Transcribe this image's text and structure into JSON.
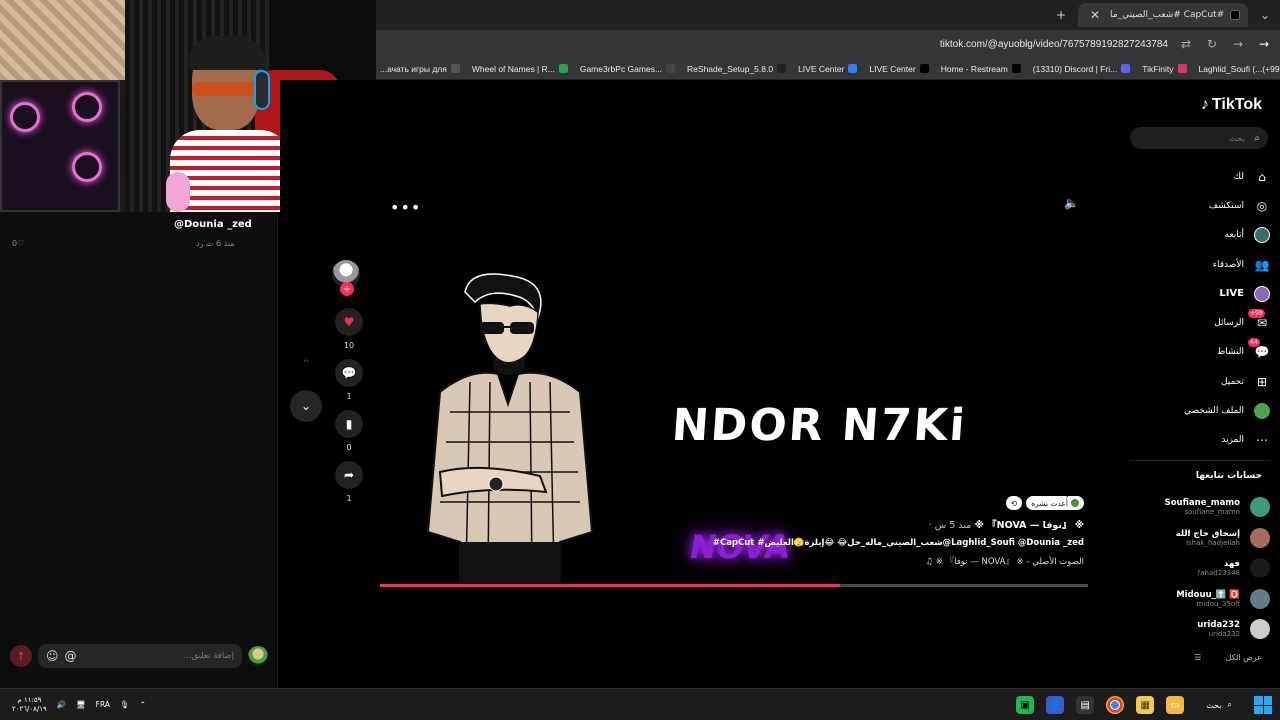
{
  "browser": {
    "tab_title": "شعب_الصيني_ما# CapCut#...",
    "url": "tiktok.com/@ayuoblg/video/7675789192827243784",
    "bookmarks": [
      {
        "label": "...ачать игры для",
        "color": "#555"
      },
      {
        "label": "Wheel of Names | R...",
        "color": "#2fa34a"
      },
      {
        "label": "Game3rbPc Games...",
        "color": "#444"
      },
      {
        "label": "ReShade_Setup_5.8.0",
        "color": "#222"
      },
      {
        "label": "LIVE Center",
        "color": "#2d7ff9"
      },
      {
        "label": "LIVE Center",
        "color": "#000"
      },
      {
        "label": "Home - Restream",
        "color": "#000"
      },
      {
        "label": "(13310) Discord | Fri...",
        "color": "#5865f2"
      },
      {
        "label": "TikFinity",
        "color": "#e2336a"
      },
      {
        "label": "Laghlid_Soufi (...(+99)",
        "color": "#c23"
      }
    ]
  },
  "comments": {
    "user": "@Dounia _zed",
    "meta": "منذ 6 ث    رد",
    "likes": "0♡",
    "input_placeholder": "...إضافة تعليق"
  },
  "video": {
    "headline": "NDOR N7Ki",
    "overlay_text": "NOVA",
    "progress_percent": 65,
    "actions": {
      "likes": "10",
      "comments": "1",
      "saves": "0",
      "shares": "1"
    },
    "caption": {
      "badge_reposted": "أُعدت نشره",
      "title": "※ 『NOVA — نوفا』 ※",
      "time": "· منذ 5 س",
      "tags": "#CapCut #شعب_الصيني_ماله_حل😂 😂إيلزة🫣العليض@Laghlid_Soufi @Dounia _zed",
      "sound": "♫ ※ 『نوفا — NOVA』 ※ - الصوت الأصلي"
    }
  },
  "sidebar": {
    "logo": "TikTok",
    "search_placeholder": "بحث",
    "nav": [
      {
        "label": "لك",
        "icon": "home-icon",
        "glyph": "⌂"
      },
      {
        "label": "استكشف",
        "icon": "compass-icon",
        "glyph": "◎"
      },
      {
        "label": "أتابعه",
        "icon": "following-avatar-icon",
        "glyph": ""
      },
      {
        "label": "الأصدقاء",
        "icon": "friends-icon",
        "glyph": "👥"
      },
      {
        "label": "LIVE",
        "icon": "live-icon",
        "glyph": ""
      },
      {
        "label": "الرسائل",
        "icon": "messages-icon",
        "glyph": "✉",
        "badge": "+99"
      },
      {
        "label": "النشاط",
        "icon": "activity-icon",
        "glyph": "💬",
        "badge": "44"
      },
      {
        "label": "تحميل",
        "icon": "upload-icon",
        "glyph": "⊞"
      },
      {
        "label": "الملف الشخصي",
        "icon": "profile-icon",
        "glyph": ""
      },
      {
        "label": "المزيد",
        "icon": "more-icon",
        "glyph": "⋯"
      }
    ],
    "following_heading": "حسابات تتابعها",
    "following": [
      {
        "name": "Soufiane_mamo",
        "handle": "soufiane_mamo",
        "color": "#3b9c7a"
      },
      {
        "name": "إسحاق حاج الله",
        "handle": "ishak_hadjellah",
        "color": "#a56b5b"
      },
      {
        "name": "فهد",
        "handle": "fahad23348",
        "color": "#1a1a1a"
      },
      {
        "name": "Midouu_⬆️ 🅾️",
        "handle": "midou_35off",
        "color": "#647b88"
      },
      {
        "name": "urida232",
        "handle": "urida232",
        "color": "#ccc"
      }
    ],
    "see_all": "عرض الكل"
  },
  "taskbar": {
    "time": "١١:٥٩ م",
    "date": "٢٠٢٦/٠٨/١٩",
    "lang": "FRA",
    "search_label": "بحث"
  }
}
